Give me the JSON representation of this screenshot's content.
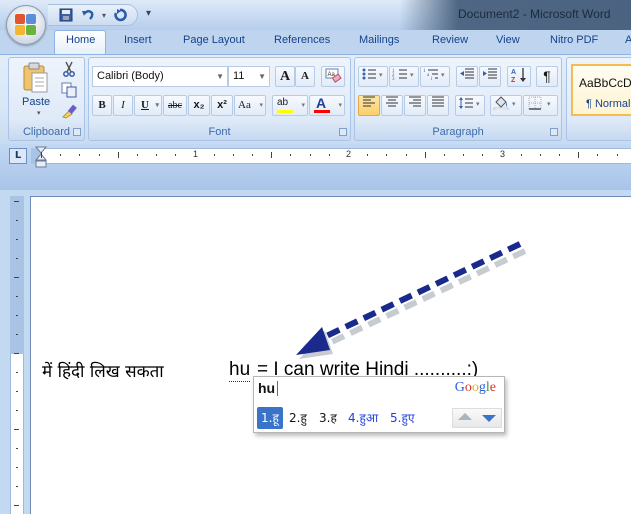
{
  "window": {
    "title": "Document2 - Microsoft Word"
  },
  "quick_access": {
    "save": "save-icon",
    "undo": "undo-icon",
    "redo": "redo-icon",
    "customize": "▾"
  },
  "tabs": [
    {
      "label": "Home",
      "active": true
    },
    {
      "label": "Insert"
    },
    {
      "label": "Page Layout"
    },
    {
      "label": "References"
    },
    {
      "label": "Mailings"
    },
    {
      "label": "Review"
    },
    {
      "label": "View"
    },
    {
      "label": "Nitro PDF"
    },
    {
      "label": "A"
    }
  ],
  "ribbon": {
    "clipboard": {
      "label": "Clipboard",
      "paste": "Paste"
    },
    "font": {
      "label": "Font",
      "font_name": "Calibri (Body)",
      "font_size": "11",
      "grow": "A",
      "shrink": "A",
      "bold": "B",
      "italic": "I",
      "underline": "U",
      "strike": "abc",
      "subscript": "x₂",
      "superscript": "x²",
      "change_case": "Aa",
      "highlight": "ab",
      "font_color": "A",
      "highlight_color": "#ffff00",
      "font_color_value": "#ff0000"
    },
    "paragraph": {
      "label": "Paragraph",
      "show_marks": "¶",
      "sort": "A↓Z"
    },
    "styles": {
      "preview": "AaBbCcD",
      "name": "¶ Normal"
    }
  },
  "ruler": {
    "numbers": [
      "1",
      "2",
      "3"
    ]
  },
  "document": {
    "hindi_text": "में  हिंदी  लिख  सकता",
    "typed_word": "hu",
    "rest": "= I can write Hindi ..........:)"
  },
  "ime": {
    "input": "hu",
    "brand": "Google",
    "brand_letters": [
      {
        "ch": "G",
        "color": "#2a5ed8"
      },
      {
        "ch": "o",
        "color": "#d6352d"
      },
      {
        "ch": "o",
        "color": "#e8b21a"
      },
      {
        "ch": "g",
        "color": "#2a5ed8"
      },
      {
        "ch": "l",
        "color": "#2e9a3a"
      },
      {
        "ch": "e",
        "color": "#d6352d"
      }
    ],
    "candidates": [
      {
        "label": "1.हू",
        "selected": true
      },
      {
        "label": "2.हु"
      },
      {
        "label": "3.ह"
      },
      {
        "label": "4.हुआ"
      },
      {
        "label": "5.हुए"
      }
    ],
    "accent": "#3a74c8"
  },
  "annotation": {
    "arrow_color": "#1a2a8c"
  }
}
